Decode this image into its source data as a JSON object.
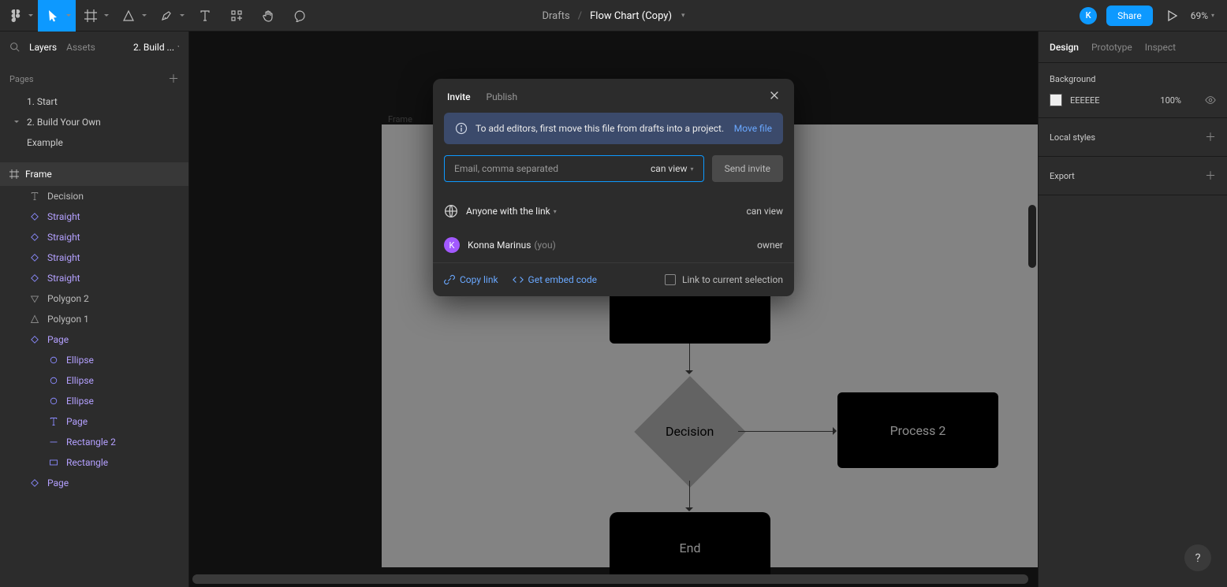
{
  "toolbar": {
    "file_location": "Drafts",
    "file_name": "Flow Chart (Copy)",
    "avatar_initial": "K",
    "share_label": "Share",
    "zoom": "69%"
  },
  "left_panel": {
    "tabs": {
      "layers": "Layers",
      "assets": "Assets"
    },
    "current_page_short": "2. Build ...",
    "pages_header": "Pages",
    "pages": [
      {
        "name": "1. Start",
        "has_caret": false
      },
      {
        "name": "2. Build Your Own",
        "has_caret": true
      },
      {
        "name": "Example",
        "has_caret": false
      }
    ],
    "frame_label": "Frame",
    "layers": [
      {
        "name": "Decision",
        "icon": "text",
        "depth": 0,
        "purple": false
      },
      {
        "name": "Straight",
        "icon": "diamond",
        "depth": 0,
        "purple": true
      },
      {
        "name": "Straight",
        "icon": "diamond",
        "depth": 0,
        "purple": true
      },
      {
        "name": "Straight",
        "icon": "diamond",
        "depth": 0,
        "purple": true
      },
      {
        "name": "Straight",
        "icon": "diamond",
        "depth": 0,
        "purple": true
      },
      {
        "name": "Polygon 2",
        "icon": "triangle-down",
        "depth": 0,
        "purple": false
      },
      {
        "name": "Polygon 1",
        "icon": "triangle-up",
        "depth": 0,
        "purple": false
      },
      {
        "name": "Page",
        "icon": "diamond",
        "depth": 0,
        "purple": true
      },
      {
        "name": "Ellipse",
        "icon": "circle",
        "depth": 1,
        "purple": true
      },
      {
        "name": "Ellipse",
        "icon": "circle",
        "depth": 1,
        "purple": true
      },
      {
        "name": "Ellipse",
        "icon": "circle",
        "depth": 1,
        "purple": true
      },
      {
        "name": "Page",
        "icon": "text",
        "depth": 1,
        "purple": true
      },
      {
        "name": "Rectangle 2",
        "icon": "line",
        "depth": 1,
        "purple": true
      },
      {
        "name": "Rectangle",
        "icon": "rect",
        "depth": 1,
        "purple": true
      },
      {
        "name": "Page",
        "icon": "diamond",
        "depth": 0,
        "purple": true
      }
    ]
  },
  "canvas": {
    "frame_label": "Frame",
    "nodes": {
      "decision": "Decision",
      "process2": "Process 2",
      "end": "End"
    }
  },
  "right_panel": {
    "tabs": {
      "design": "Design",
      "prototype": "Prototype",
      "inspect": "Inspect"
    },
    "background_label": "Background",
    "background_hex": "EEEEEE",
    "background_opacity": "100%",
    "local_styles_label": "Local styles",
    "export_label": "Export"
  },
  "modal": {
    "tabs": {
      "invite": "Invite",
      "publish": "Publish"
    },
    "banner_text": "To add editors, first move this file from drafts into a project.",
    "banner_action": "Move file",
    "email_placeholder": "Email, comma separated",
    "permission": "can view",
    "send_label": "Send invite",
    "anyone_label": "Anyone with the link",
    "anyone_role": "can view",
    "user_name": "Konna Marinus",
    "user_you": "(you)",
    "user_initial": "K",
    "user_role": "owner",
    "copy_link": "Copy link",
    "embed": "Get embed code",
    "link_selection": "Link to current selection"
  },
  "help_label": "?"
}
